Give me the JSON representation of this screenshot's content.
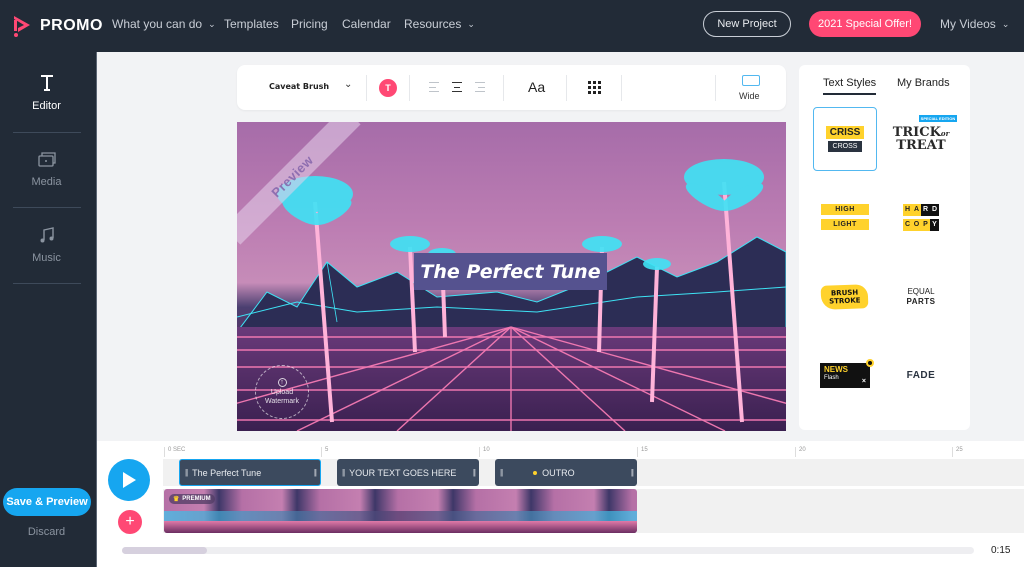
{
  "brand": {
    "name": "PROMO",
    "accent": "#ff4874",
    "primary": "#16a6f0",
    "nav_bg": "#222b37"
  },
  "topnav": {
    "items": [
      {
        "label": "What you can do",
        "has_dropdown": true
      },
      {
        "label": "Templates",
        "has_dropdown": false
      },
      {
        "label": "Pricing",
        "has_dropdown": false
      },
      {
        "label": "Calendar",
        "has_dropdown": false
      },
      {
        "label": "Resources",
        "has_dropdown": true
      }
    ],
    "new_project": "New Project",
    "special_offer": "2021 Special Offer!",
    "my_videos": "My Videos"
  },
  "sidebar": {
    "items": [
      {
        "label": "Editor",
        "icon": "text-icon",
        "active": true
      },
      {
        "label": "Media",
        "icon": "media-icon",
        "active": false
      },
      {
        "label": "Music",
        "icon": "music-note-icon",
        "active": false
      }
    ],
    "save_preview": "Save & Preview",
    "discard": "Discard"
  },
  "toolbar": {
    "font": "Caveat Brush",
    "color_letter": "T",
    "aa": "Aa",
    "aspect_label": "Wide",
    "alignments": [
      "left",
      "center",
      "right"
    ],
    "active_alignment": "center"
  },
  "canvas": {
    "ribbon": "Preview",
    "title": "The Perfect Tune",
    "watermark": "Upload Watermark"
  },
  "right_panel": {
    "tabs": [
      {
        "label": "Text Styles",
        "active": true
      },
      {
        "label": "My Brands",
        "active": false
      }
    ],
    "styles": {
      "criss_cross": {
        "top": "CRISS",
        "bottom": "CROSS",
        "selected": true
      },
      "trick_treat": {
        "line1": "TRICK",
        "or": "or",
        "line2": "TREAT",
        "badge": "SPECIAL EDITION"
      },
      "highlight": {
        "line1": "HIGH",
        "line2": "LIGHT"
      },
      "hard_copy": {
        "line1": [
          "H",
          "A",
          "R",
          "D"
        ],
        "line2": [
          "C",
          "O",
          "P",
          "Y"
        ]
      },
      "brush_stroke": {
        "line1": "BRUSH",
        "line2": "STROKE"
      },
      "equal_parts": {
        "line1": "EQUAL",
        "line2": "PARTS"
      },
      "news_flash": {
        "line1": "NEWS",
        "line2": "Flash",
        "close": "×"
      },
      "fade": {
        "label": "FADE"
      }
    }
  },
  "timeline": {
    "ticks": [
      "0 SEC",
      "5",
      "10",
      "15",
      "20",
      "25"
    ],
    "clips": [
      {
        "label": "The Perfect Tune",
        "selected": true
      },
      {
        "label": "YOUR TEXT GOES HERE",
        "selected": false
      },
      {
        "label": "OUTRO",
        "selected": false,
        "marker": true
      }
    ],
    "video_badge": "PREMIUM",
    "duration": "0:15",
    "scroll_position": 0.1
  }
}
